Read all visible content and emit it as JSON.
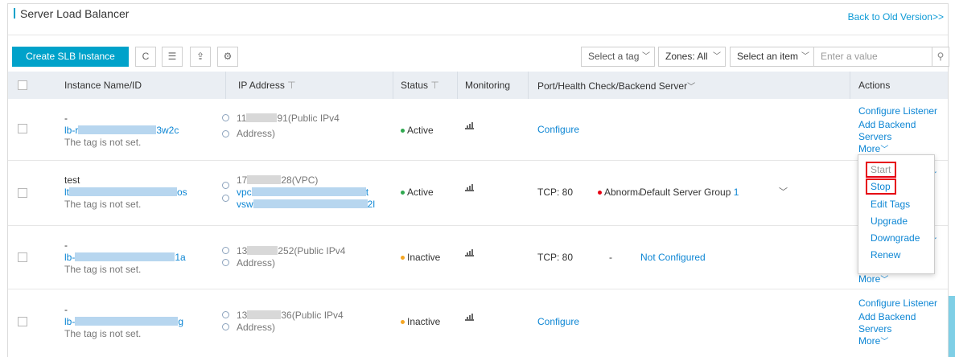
{
  "page": {
    "title": "Server Load Balancer",
    "back_link": "Back to Old Version>>"
  },
  "toolbar": {
    "create_label": "Create SLB Instance",
    "refresh_icon": "C",
    "list_icon": "☰",
    "export_icon": "⇪",
    "settings_icon": "⚙",
    "tag_select": "Select a tag",
    "zones_select": "Zones: All",
    "item_select": "Select an item",
    "search_placeholder": "Enter a value",
    "search_icon": "⚲",
    "chevron": "﹀"
  },
  "table": {
    "headers": {
      "name": "Instance Name/ID",
      "ip": "IP Address",
      "status": "Status",
      "monitoring": "Monitoring",
      "port": "Port/Health Check/Backend Server",
      "actions": "Actions"
    },
    "filter_icon": "⊤",
    "rows": [
      {
        "name": "-",
        "id_start": "lb-r",
        "id_end": "3w2c",
        "tag": "The tag is not set.",
        "ip_start": "11",
        "ip_end": "91(Public IPv4",
        "ip_line2": "Address)",
        "status": "Active",
        "port": "Configure",
        "actions": [
          "Configure Listener",
          "Add Backend",
          "Servers",
          "More"
        ]
      },
      {
        "name": "test",
        "id_start": "lt",
        "id_end": "os",
        "tag": "The tag is not set.",
        "ip_start": "17",
        "ip_end": "28(VPC)",
        "vpc_start": "vpc",
        "vpc_end": "t",
        "vsw_start": "vsw",
        "vsw_end": "2l",
        "status": "Active",
        "port": "TCP: 80",
        "health": "Abnormal",
        "backend_text": "Default Server Group",
        "backend_num": "1",
        "actions_partial": "r"
      },
      {
        "name": "-",
        "id_start": "lb-",
        "id_end": "1a",
        "tag": "The tag is not set.",
        "ip_start": "13",
        "ip_end": "252(Public IPv4",
        "ip_line2": "Address)",
        "status": "Inactive",
        "port": "TCP: 80",
        "health": "-",
        "backend_text": "Not Configured",
        "actions_partial": "r",
        "more": "More"
      },
      {
        "name": "-",
        "id_start": "lb-",
        "id_end": "g",
        "tag": "The tag is not set.",
        "ip_start": "13",
        "ip_end": "36(Public IPv4",
        "ip_line2": "Address)",
        "status": "Inactive",
        "port": "Configure",
        "actions": [
          "Configure Listener",
          "Add Backend",
          "Servers",
          "More"
        ]
      }
    ]
  },
  "dropdown": {
    "items": [
      "Start",
      "Stop",
      "Edit Tags",
      "Upgrade",
      "Downgrade",
      "Renew"
    ]
  },
  "colors": {
    "primary": "#00a2ca",
    "link": "#0d86d4",
    "active": "#2fa84f",
    "inactive": "#f5a623",
    "abnormal": "#e60012",
    "highlight": "#e60012"
  }
}
